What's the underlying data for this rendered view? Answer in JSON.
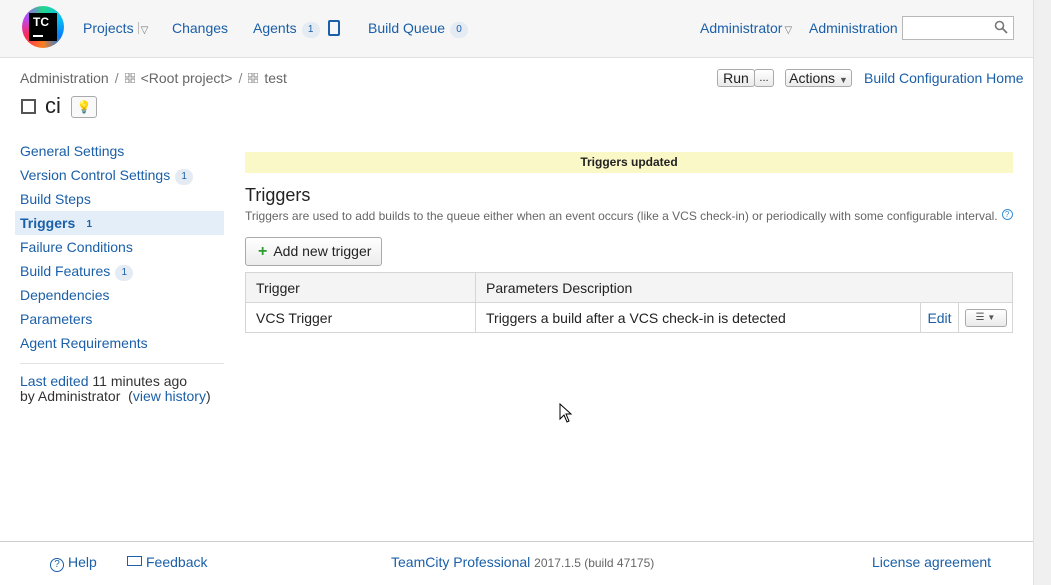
{
  "header": {
    "logo_text": "TC",
    "nav": {
      "projects": "Projects",
      "changes": "Changes",
      "agents": "Agents",
      "agents_count": "1",
      "build_queue": "Build Queue",
      "build_queue_count": "0",
      "user": "Administrator",
      "administration": "Administration"
    },
    "search": {
      "placeholder": "",
      "value": ""
    }
  },
  "breadcrumb": {
    "items": [
      "Administration",
      "<Root project>",
      "test"
    ],
    "separator": "/"
  },
  "page": {
    "title": "ci",
    "buttons": {
      "run": "Run",
      "run_more": "...",
      "actions": "Actions",
      "home": "Build Configuration Home"
    }
  },
  "sidebar": {
    "items": [
      {
        "label": "General Settings",
        "badge": ""
      },
      {
        "label": "Version Control Settings",
        "badge": "1"
      },
      {
        "label": "Build Steps",
        "badge": ""
      },
      {
        "label": "Triggers",
        "badge": "1"
      },
      {
        "label": "Failure Conditions",
        "badge": ""
      },
      {
        "label": "Build Features",
        "badge": "1"
      },
      {
        "label": "Dependencies",
        "badge": ""
      },
      {
        "label": "Parameters",
        "badge": ""
      },
      {
        "label": "Agent Requirements",
        "badge": ""
      }
    ],
    "active_index": 3,
    "last_edited": {
      "link": "Last edited",
      "time": "11 minutes ago",
      "by": "by Administrator",
      "history": "view history"
    }
  },
  "main": {
    "banner": "Triggers updated",
    "title": "Triggers",
    "description": "Triggers are used to add builds to the queue either when an event occurs (like a VCS check-in) or periodically with some configurable interval.",
    "add_button": "Add new trigger",
    "table": {
      "headers": [
        "Trigger",
        "Parameters Description"
      ],
      "rows": [
        {
          "trigger": "VCS Trigger",
          "description": "Triggers a build after a VCS check-in is detected",
          "edit": "Edit"
        }
      ]
    }
  },
  "footer": {
    "help": "Help",
    "feedback": "Feedback",
    "product": "TeamCity Professional",
    "version": "2017.1.5 (build 47175)",
    "license": "License agreement"
  },
  "colors": {
    "link": "#1a5fa8",
    "banner_bg": "#fbf8c8",
    "active_bg": "#e4eef8",
    "add_icon": "#2d9e2d"
  }
}
